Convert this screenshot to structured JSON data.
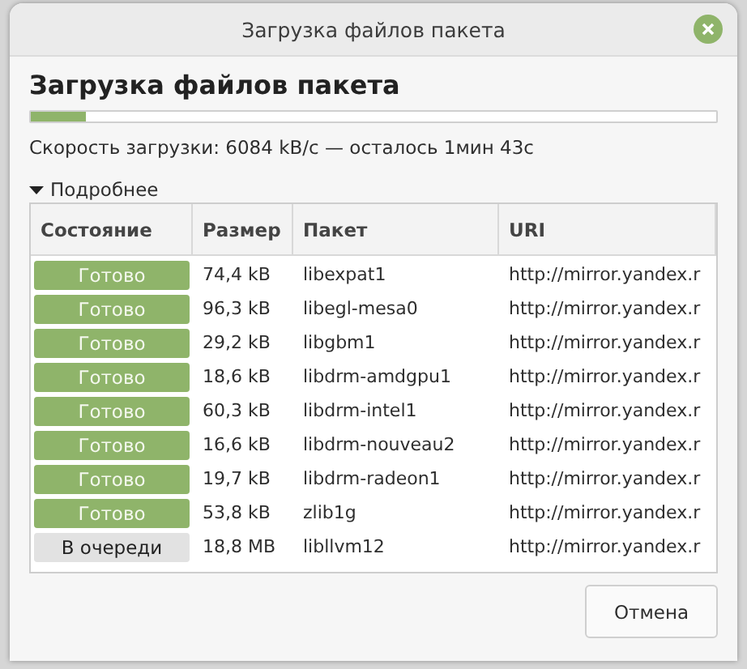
{
  "window": {
    "title": "Загрузка файлов пакета"
  },
  "heading": "Загрузка файлов пакета",
  "progress": {
    "level": 0.08
  },
  "speed_text": "Скорость загрузки: 6084 kB/c — осталось 1мин 43с",
  "details": {
    "label": "Подробнее",
    "expanded": true
  },
  "table": {
    "columns": [
      "Состояние",
      "Размер",
      "Пакет",
      "URI"
    ],
    "rows": [
      {
        "status": "Готово",
        "kind": "done",
        "size": "74,4 kB",
        "package": "libexpat1",
        "uri": "http://mirror.yandex.r"
      },
      {
        "status": "Готово",
        "kind": "done",
        "size": "96,3 kB",
        "package": "libegl-mesa0",
        "uri": "http://mirror.yandex.r"
      },
      {
        "status": "Готово",
        "kind": "done",
        "size": "29,2 kB",
        "package": "libgbm1",
        "uri": "http://mirror.yandex.r"
      },
      {
        "status": "Готово",
        "kind": "done",
        "size": "18,6 kB",
        "package": "libdrm-amdgpu1",
        "uri": "http://mirror.yandex.r"
      },
      {
        "status": "Готово",
        "kind": "done",
        "size": "60,3 kB",
        "package": "libdrm-intel1",
        "uri": "http://mirror.yandex.r"
      },
      {
        "status": "Готово",
        "kind": "done",
        "size": "16,6 kB",
        "package": "libdrm-nouveau2",
        "uri": "http://mirror.yandex.r"
      },
      {
        "status": "Готово",
        "kind": "done",
        "size": "19,7 kB",
        "package": "libdrm-radeon1",
        "uri": "http://mirror.yandex.r"
      },
      {
        "status": "Готово",
        "kind": "done",
        "size": "53,8 kB",
        "package": "zlib1g",
        "uri": "http://mirror.yandex.r"
      },
      {
        "status": "В очереди",
        "kind": "queued",
        "size": "18,8 MB",
        "package": "libllvm12",
        "uri": "http://mirror.yandex.r"
      }
    ]
  },
  "buttons": [
    "Отмена"
  ]
}
